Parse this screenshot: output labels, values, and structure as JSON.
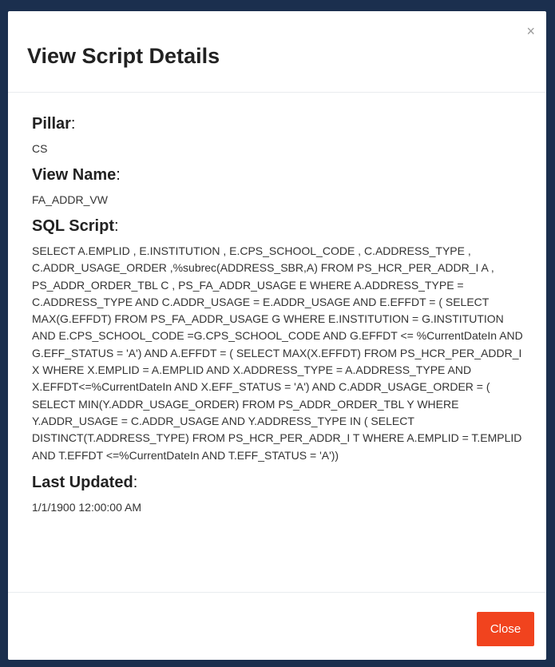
{
  "modal": {
    "title": "View Script Details",
    "close_symbol": "×",
    "fields": {
      "pillar_label": "Pillar",
      "pillar_value": "CS",
      "view_name_label": "View Name",
      "view_name_value": "FA_ADDR_VW",
      "sql_script_label": "SQL Script",
      "sql_script_value": "SELECT A.EMPLID , E.INSTITUTION , E.CPS_SCHOOL_CODE , C.ADDRESS_TYPE , C.ADDR_USAGE_ORDER ,%subrec(ADDRESS_SBR,A) FROM PS_HCR_PER_ADDR_I A , PS_ADDR_ORDER_TBL C , PS_FA_ADDR_USAGE E WHERE A.ADDRESS_TYPE = C.ADDRESS_TYPE AND C.ADDR_USAGE = E.ADDR_USAGE AND E.EFFDT = ( SELECT MAX(G.EFFDT) FROM PS_FA_ADDR_USAGE G WHERE E.INSTITUTION = G.INSTITUTION AND E.CPS_SCHOOL_CODE =G.CPS_SCHOOL_CODE AND G.EFFDT <= %CurrentDateIn AND G.EFF_STATUS = 'A') AND A.EFFDT = ( SELECT MAX(X.EFFDT) FROM PS_HCR_PER_ADDR_I X WHERE X.EMPLID = A.EMPLID AND X.ADDRESS_TYPE = A.ADDRESS_TYPE AND X.EFFDT<=%CurrentDateIn AND X.EFF_STATUS = 'A') AND C.ADDR_USAGE_ORDER = ( SELECT MIN(Y.ADDR_USAGE_ORDER) FROM PS_ADDR_ORDER_TBL Y WHERE Y.ADDR_USAGE = C.ADDR_USAGE AND Y.ADDRESS_TYPE IN ( SELECT DISTINCT(T.ADDRESS_TYPE) FROM PS_HCR_PER_ADDR_I T WHERE A.EMPLID = T.EMPLID AND T.EFFDT <=%CurrentDateIn AND T.EFF_STATUS = 'A'))",
      "last_updated_label": "Last Updated",
      "last_updated_value": "1/1/1900 12:00:00 AM",
      "colon": ":"
    },
    "footer": {
      "close_label": "Close"
    }
  },
  "colors": {
    "backdrop": "#1b2f4e",
    "close_button": "#f1431e"
  },
  "icons": {
    "close": "close-icon"
  }
}
